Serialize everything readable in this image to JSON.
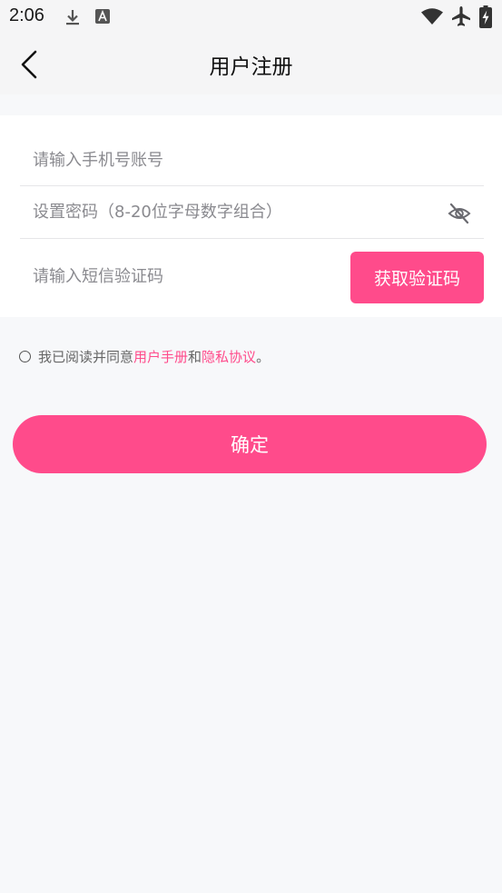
{
  "status_bar": {
    "time": "2:06",
    "icons": [
      "download-icon",
      "font-icon",
      "wifi-icon",
      "airplane-icon",
      "battery-charging-icon"
    ]
  },
  "header": {
    "title": "用户注册",
    "back_icon": "chevron-left-icon"
  },
  "form": {
    "phone_placeholder": "请输入手机号账号",
    "password_placeholder": "设置密码（8-20位字母数字组合）",
    "password_toggle_icon": "eye-off-icon",
    "sms_placeholder": "请输入短信验证码",
    "get_code_label": "获取验证码"
  },
  "agreement": {
    "prefix": "我已阅读并同意",
    "manual_link": "用户手册",
    "conjunction": "和",
    "privacy_link": "隐私协议",
    "suffix": "。"
  },
  "confirm_label": "确定",
  "colors": {
    "accent": "#ff4b8b",
    "background": "#f7f8fa",
    "header_background": "#f5f5f6"
  }
}
